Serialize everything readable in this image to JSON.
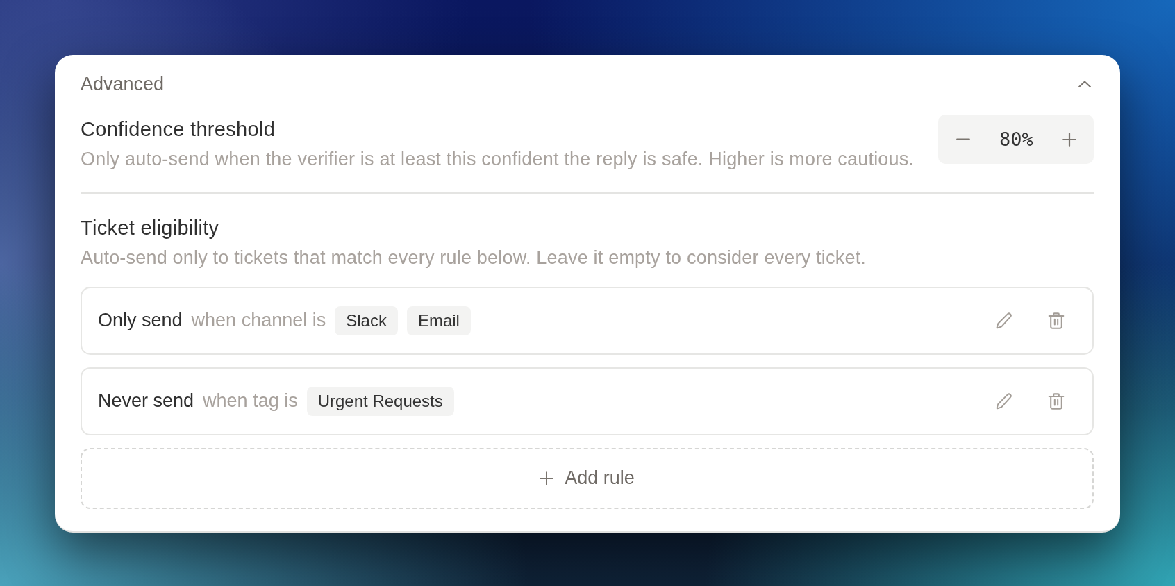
{
  "section": {
    "title": "Advanced",
    "expanded": true
  },
  "confidence": {
    "title": "Confidence threshold",
    "description": "Only auto-send when the verifier is at least this confident the reply is safe. Higher is more cautious.",
    "value": "80%"
  },
  "eligibility": {
    "title": "Ticket eligibility",
    "description": "Auto-send only to tickets that match every rule below. Leave it empty to consider every ticket.",
    "rules": [
      {
        "action": "Only send",
        "condition": "when channel is",
        "values": [
          "Slack",
          "Email"
        ]
      },
      {
        "action": "Never send",
        "condition": "when tag is",
        "values": [
          "Urgent Requests"
        ]
      }
    ],
    "add_button": "Add rule"
  }
}
